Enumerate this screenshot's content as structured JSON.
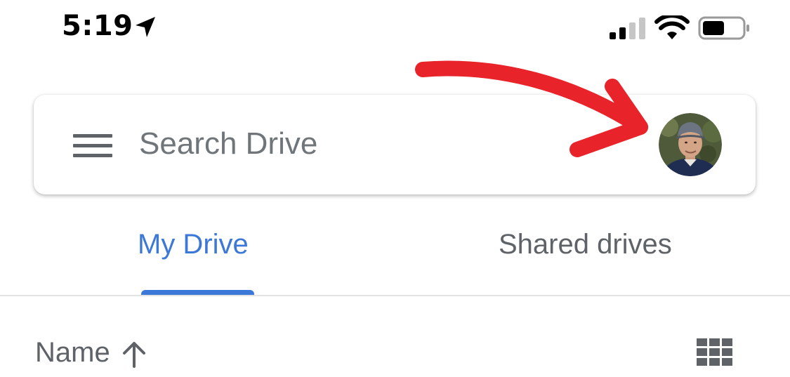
{
  "status_bar": {
    "time": "5:19",
    "icons": [
      "location-arrow-icon",
      "cellular-signal-icon",
      "wifi-icon",
      "battery-icon"
    ]
  },
  "search": {
    "menu_icon": "hamburger-menu-icon",
    "placeholder": "Search Drive",
    "value": "",
    "avatar_icon": "account-avatar-icon"
  },
  "annotation": {
    "type": "red-arrow",
    "color": "#e8232a",
    "points_to": "account avatar"
  },
  "tabs": [
    {
      "label": "My Drive",
      "active": true
    },
    {
      "label": "Shared drives",
      "active": false
    }
  ],
  "sort": {
    "label": "Name",
    "direction_icon": "arrow-up-icon",
    "view_toggle_icon": "grid-view-icon"
  },
  "colors": {
    "accent": "#3c78d8",
    "text_muted": "#5f6368",
    "annotation_red": "#e8232a"
  }
}
